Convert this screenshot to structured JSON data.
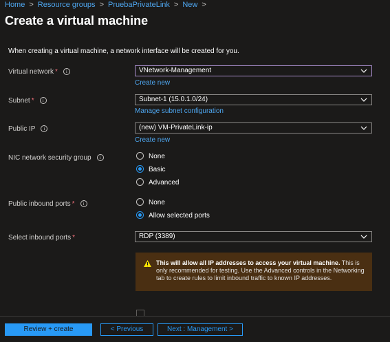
{
  "breadcrumb": {
    "items": [
      "Home",
      "Resource groups",
      "PruebaPrivateLink",
      "New"
    ]
  },
  "page": {
    "title": "Create a virtual machine"
  },
  "intro": "When creating a virtual machine, a network interface will be created for you.",
  "fields": {
    "virtual_network": {
      "label": "Virtual network",
      "value": "VNetwork-Management",
      "link": "Create new"
    },
    "subnet": {
      "label": "Subnet",
      "value": "Subnet-1 (15.0.1.0/24)",
      "link": "Manage subnet configuration"
    },
    "public_ip": {
      "label": "Public IP",
      "value": "(new) VM-PrivateLink-ip",
      "link": "Create new"
    },
    "nic_nsg": {
      "label": "NIC network security group",
      "options": [
        "None",
        "Basic",
        "Advanced"
      ],
      "selected": "Basic"
    },
    "public_inbound": {
      "label": "Public inbound ports",
      "options": [
        "None",
        "Allow selected ports"
      ],
      "selected": "Allow selected ports"
    },
    "select_inbound": {
      "label": "Select inbound ports",
      "value": "RDP (3389)"
    }
  },
  "warning": {
    "bold": "This will allow all IP addresses to access your virtual machine.",
    "text": " This is only recommended for testing.  Use the Advanced controls in the Networking tab to create rules to limit inbound traffic to known IP addresses."
  },
  "footer": {
    "review_create": "Review + create",
    "previous": "< Previous",
    "next": "Next : Management >"
  },
  "colors": {
    "accent": "#2899f5",
    "link": "#4ea6ef",
    "warning_bg": "#4a2f12",
    "required": "#f1707b"
  }
}
